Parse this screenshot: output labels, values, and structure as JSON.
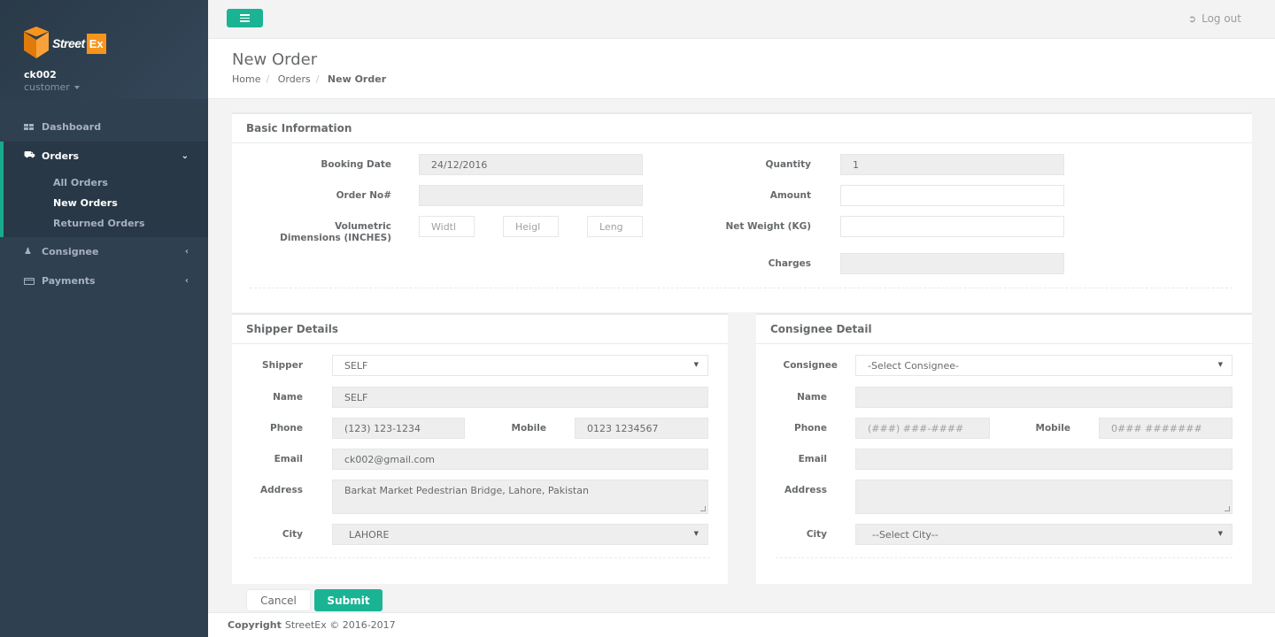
{
  "sidebar": {
    "logo_text": "Street",
    "logo_ex": "Ex",
    "username": "ck002",
    "role": "customer",
    "nav": [
      {
        "label": "Dashboard",
        "icon": "grid-icon"
      },
      {
        "label": "Orders",
        "icon": "truck-icon"
      },
      {
        "label": "Consignee",
        "icon": "users-icon"
      },
      {
        "label": "Payments",
        "icon": "credit-card-icon"
      }
    ],
    "orders_sub": [
      "All Orders",
      "New Orders",
      "Returned Orders"
    ]
  },
  "topbar": {
    "logout": "Log out"
  },
  "heading": {
    "title": "New Order",
    "crumbs": [
      "Home",
      "Orders",
      "New Order"
    ]
  },
  "basic": {
    "title": "Basic Information",
    "booking_date_label": "Booking Date",
    "booking_date": "24/12/2016",
    "order_no_label": "Order No#",
    "order_no": "",
    "vol_label_1": "Volumetric",
    "vol_label_2": "Dimensions (INCHES)",
    "width_ph": "Widtl",
    "height_ph": "Heigl",
    "length_ph": "Leng",
    "quantity_label": "Quantity",
    "quantity": "1",
    "amount_label": "Amount",
    "amount": "",
    "net_weight_label": "Net Weight (KG)",
    "net_weight": "",
    "charges_label": "Charges",
    "charges": ""
  },
  "shipper": {
    "title": "Shipper Details",
    "shipper_label": "Shipper",
    "shipper": "SELF",
    "name_label": "Name",
    "name": "SELF",
    "phone_label": "Phone",
    "phone": "(123) 123-1234",
    "mobile_label": "Mobile",
    "mobile": "0123 1234567",
    "email_label": "Email",
    "email": "ck002@gmail.com",
    "address_label": "Address",
    "address": "Barkat Market Pedestrian Bridge, Lahore, Pakistan",
    "city_label": "City",
    "city": "LAHORE"
  },
  "consignee": {
    "title": "Consignee Detail",
    "consignee_label": "Consignee",
    "consignee": "-Select Consignee-",
    "name_label": "Name",
    "name": "",
    "phone_label": "Phone",
    "phone_ph": "(###) ###-####",
    "mobile_label": "Mobile",
    "mobile_ph": "0### #######",
    "email_label": "Email",
    "email": "",
    "address_label": "Address",
    "address": "",
    "city_label": "City",
    "city": "--Select City--"
  },
  "actions": {
    "cancel": "Cancel",
    "submit": "Submit"
  },
  "footer": {
    "copyright": "Copyright",
    "text": "StreetEx © 2016-2017"
  }
}
